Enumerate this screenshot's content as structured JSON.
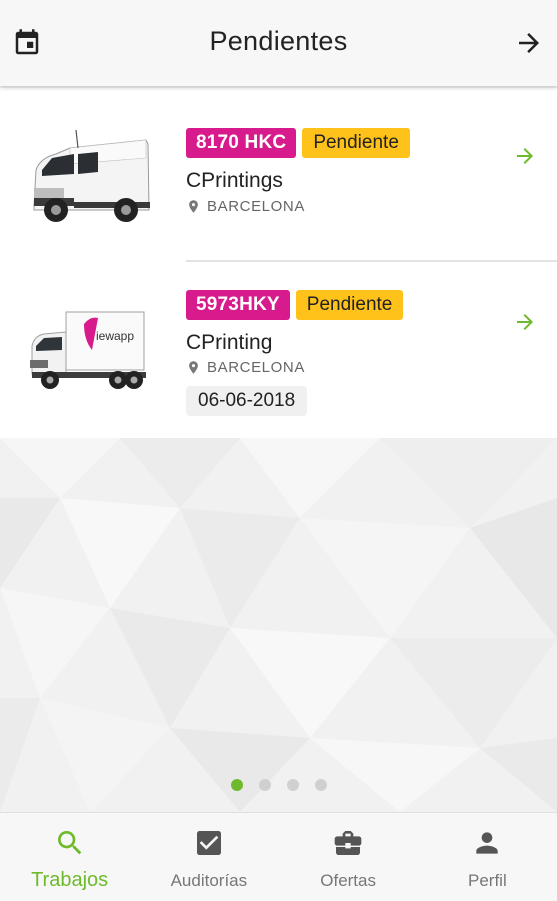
{
  "header": {
    "title": "Pendientes"
  },
  "jobs": [
    {
      "plate": "8170 HKC",
      "status": "Pendiente",
      "company": "CPrintings",
      "location": "BARCELONA",
      "date": ""
    },
    {
      "plate": "5973HKY",
      "status": "Pendiente",
      "company": "CPrinting",
      "location": "BARCELONA",
      "date": "06-06-2018"
    }
  ],
  "pager": {
    "count": 4,
    "active": 1
  },
  "nav": [
    {
      "label": "Trabajos",
      "icon": "search-icon",
      "active": true
    },
    {
      "label": "Auditorías",
      "icon": "checkbox-icon",
      "active": false
    },
    {
      "label": "Ofertas",
      "icon": "briefcase-icon",
      "active": false
    },
    {
      "label": "Perfil",
      "icon": "person-icon",
      "active": false
    }
  ],
  "colors": {
    "accent": "#6fba2c",
    "plate": "#d81b8c",
    "status": "#ffc21a"
  },
  "logo_text": "iewapp"
}
